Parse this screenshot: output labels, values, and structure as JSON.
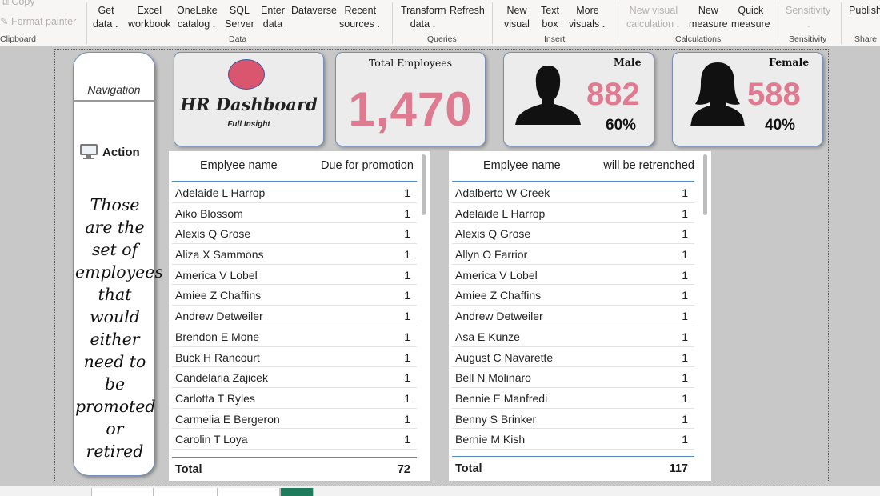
{
  "ribbon": {
    "clipboard": {
      "copy": "Copy",
      "format_painter": "Format painter",
      "group": "Clipboard"
    },
    "data": {
      "get_data": [
        "Get",
        "data"
      ],
      "excel": [
        "Excel",
        "workbook"
      ],
      "onelake": [
        "OneLake",
        "catalog"
      ],
      "sql": [
        "SQL",
        "Server"
      ],
      "enter": [
        "Enter",
        "data"
      ],
      "dataverse": "Dataverse",
      "recent": [
        "Recent",
        "sources"
      ],
      "group": "Data"
    },
    "queries": {
      "transform": [
        "Transform",
        "data"
      ],
      "refresh": "Refresh",
      "group": "Queries"
    },
    "insert": {
      "new_visual": [
        "New",
        "visual"
      ],
      "text_box": [
        "Text",
        "box"
      ],
      "more": [
        "More",
        "visuals"
      ],
      "group": "Insert"
    },
    "calculations": {
      "new_visual_calc": [
        "New visual",
        "calculation"
      ],
      "new_measure": [
        "New",
        "measure"
      ],
      "quick": [
        "Quick",
        "measure"
      ],
      "group": "Calculations"
    },
    "sensitivity": {
      "label": "Sensitivity",
      "group": "Sensitivity"
    },
    "share": {
      "publish": "Publish",
      "group": "Share"
    }
  },
  "nav": {
    "title": "Navigation",
    "action": "Action",
    "description": "Those are the set of employees that would either need to be promoted or retired"
  },
  "logo": {
    "title": "HR Dashboard",
    "subtitle": "Full Insight"
  },
  "total": {
    "label": "Total Employees",
    "value": "1,470"
  },
  "male": {
    "label": "Male",
    "value": "882",
    "pct": "60%"
  },
  "female": {
    "label": "Female",
    "value": "588",
    "pct": "40%"
  },
  "promotion_table": {
    "col1": "Emplyee name",
    "col2": "Due for promotion",
    "rows": [
      {
        "name": "Adelaide L Harrop",
        "value": "1"
      },
      {
        "name": "Aiko Blossom",
        "value": "1"
      },
      {
        "name": "Alexis Q Grose",
        "value": "1"
      },
      {
        "name": "Aliza X Sammons",
        "value": "1"
      },
      {
        "name": "America V Lobel",
        "value": "1"
      },
      {
        "name": "Amiee Z Chaffins",
        "value": "1"
      },
      {
        "name": "Andrew Detweiler",
        "value": "1"
      },
      {
        "name": "Brendon E Mone",
        "value": "1"
      },
      {
        "name": "Buck H Rancourt",
        "value": "1"
      },
      {
        "name": "Candelaria Zajicek",
        "value": "1"
      },
      {
        "name": "Carlotta T Ryles",
        "value": "1"
      },
      {
        "name": "Carmelia E Bergeron",
        "value": "1"
      },
      {
        "name": "Carolin T Loya",
        "value": "1"
      }
    ],
    "total_label": "Total",
    "total_value": "72"
  },
  "retrench_table": {
    "col1": "Emplyee name",
    "col2": "will be retrenched",
    "rows": [
      {
        "name": "Adalberto W Creek",
        "value": "1"
      },
      {
        "name": "Adelaide L Harrop",
        "value": "1"
      },
      {
        "name": "Alexis Q Grose",
        "value": "1"
      },
      {
        "name": "Allyn O Farrior",
        "value": "1"
      },
      {
        "name": "America V Lobel",
        "value": "1"
      },
      {
        "name": "Amiee Z Chaffins",
        "value": "1"
      },
      {
        "name": "Andrew Detweiler",
        "value": "1"
      },
      {
        "name": "Asa E Kunze",
        "value": "1"
      },
      {
        "name": "August C Navarette",
        "value": "1"
      },
      {
        "name": "Bell N Molinaro",
        "value": "1"
      },
      {
        "name": "Bennie E Manfredi",
        "value": "1"
      },
      {
        "name": "Benny S Brinker",
        "value": "1"
      },
      {
        "name": "Bernie M Kish",
        "value": "1"
      }
    ],
    "total_label": "Total",
    "total_value": "117"
  },
  "colors": {
    "accent_pink": "#e07a90",
    "table_rule": "#4a8ec4",
    "card_border": "#7a8fb8"
  }
}
